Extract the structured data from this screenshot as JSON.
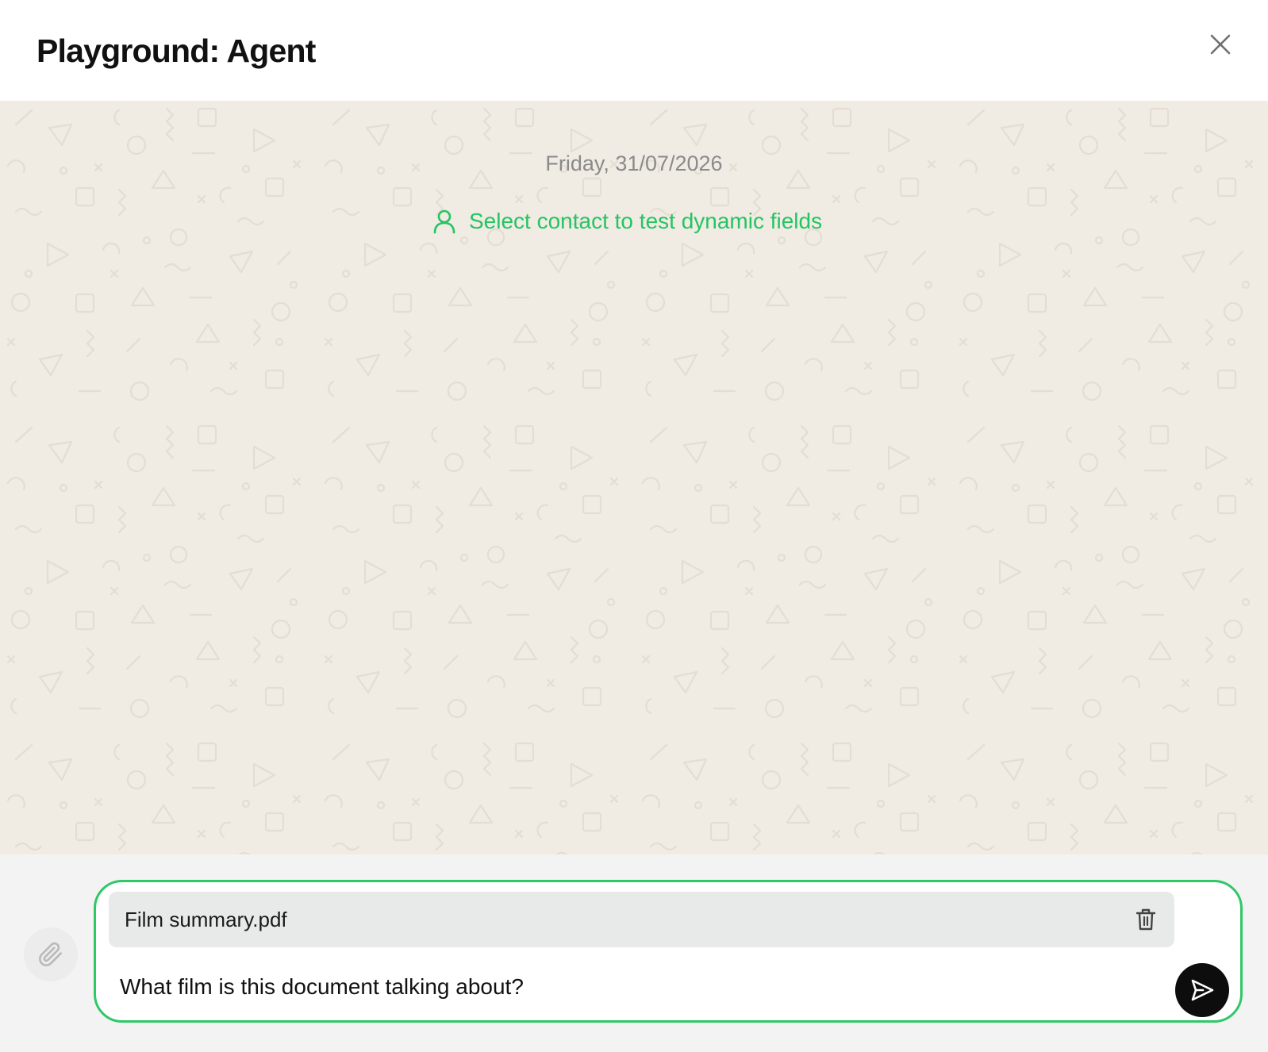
{
  "dialog": {
    "title": "Playground: Agent",
    "close_icon": "close-icon"
  },
  "chat": {
    "date_label": "Friday, 31/07/2026",
    "contact_link": {
      "icon": "user-icon",
      "label": "Select contact to test dynamic fields"
    },
    "background_color": "#f0ebe3"
  },
  "composer": {
    "attach_icon": "paperclip-icon",
    "attachment": {
      "file_name": "Film summary.pdf",
      "remove_icon": "trash-icon"
    },
    "message_value": "What film is this document talking about?",
    "send_icon": "send-icon"
  },
  "colors": {
    "accent_green": "#25c462",
    "composer_border": "#2ec866",
    "send_button": "#0d0d0d"
  }
}
